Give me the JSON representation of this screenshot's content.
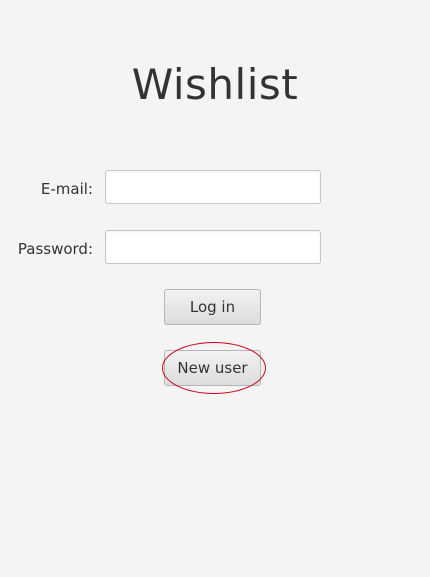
{
  "app": {
    "title": "Wishlist"
  },
  "form": {
    "email_label": "E-mail:",
    "email_value": "",
    "password_label": "Password:",
    "password_value": ""
  },
  "buttons": {
    "login_label": "Log in",
    "new_user_label": "New user"
  },
  "colors": {
    "background": "#f4f4f4",
    "highlight_annotation": "#d0021b"
  }
}
